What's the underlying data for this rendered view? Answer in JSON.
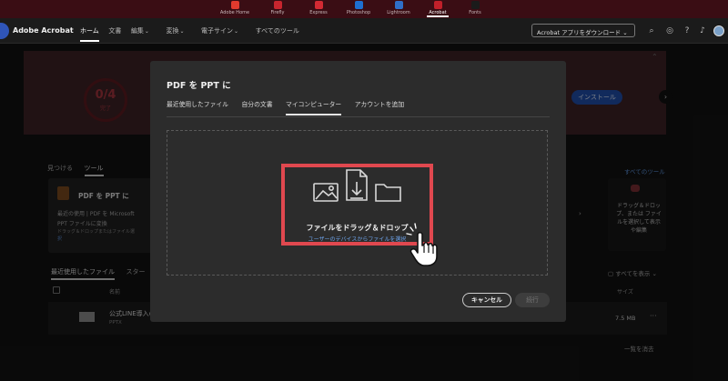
{
  "app_switcher": {
    "apps": [
      {
        "label": "Adobe Home",
        "color": "#e03a2e"
      },
      {
        "label": "Firefly",
        "color": "#c8252e"
      },
      {
        "label": "Express",
        "color": "#d22a33"
      },
      {
        "label": "Photoshop",
        "color": "#1e6fd0"
      },
      {
        "label": "Lightroom",
        "color": "#2f6fc8"
      },
      {
        "label": "Acrobat",
        "color": "#c0202a",
        "active": true
      },
      {
        "label": "Fonts",
        "color": "#1b1b1b"
      }
    ]
  },
  "header": {
    "brand": "Adobe Acrobat",
    "nav": [
      "ホーム",
      "文書",
      "編集",
      "変換",
      "電子サイン",
      "すべてのツール"
    ],
    "download_button": "Acrobat アプリをダウンロード",
    "icons": [
      "search-icon",
      "check-circle-icon",
      "help-icon",
      "bell-icon",
      "avatar"
    ]
  },
  "banner": {
    "progress_count": "0/4",
    "progress_label": "完了",
    "install_button": "インストール"
  },
  "tools": {
    "tabs": [
      "見つける",
      "ツール"
    ],
    "all_tools_link": "すべてのツール",
    "card": {
      "title": "PDF を PPT に",
      "desc1": "最近の使用 | PDF を Microsoft",
      "desc2": "PPT ファイルに変換",
      "desc3": "ドラッグ＆ドロップまたはファイル選",
      "desc3b": "択"
    },
    "right_card_text": "ドラッグ＆ドロップ、または ファイルを選択して表示 や編集"
  },
  "files": {
    "tabs": [
      "最近使用したファイル",
      "スター"
    ],
    "show_all": "すべてを表示",
    "col_name": "名前",
    "col_size": "サイズ",
    "rows": [
      {
        "name": "公式LINE導入の",
        "type": "PPTX",
        "size": "7.5 MB"
      }
    ],
    "clear_list": "一覧を消去"
  },
  "modal": {
    "title": "PDF を PPT に",
    "tabs": [
      "最近使用したファイル",
      "自分の文書",
      "マイコンピューター",
      "アカウントを追加"
    ],
    "active_tab": 2,
    "drop_text": "ファイルをドラッグ＆ドロップ",
    "drop_link": "ユーザーのデバイスからファイルを選択",
    "cancel_button": "キャンセル",
    "continue_button": "続行"
  },
  "colors": {
    "highlight": "#e0484f",
    "link": "#6ea4ec",
    "install": "#1f4da8"
  }
}
